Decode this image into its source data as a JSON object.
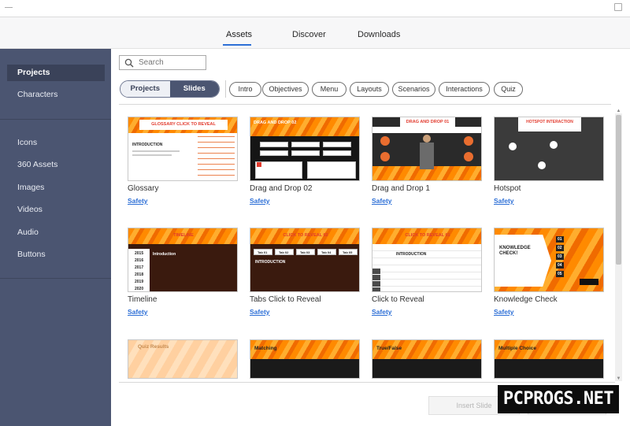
{
  "top_tabs": [
    {
      "label": "Assets",
      "active": true
    },
    {
      "label": "Discover",
      "active": false
    },
    {
      "label": "Downloads",
      "active": false
    }
  ],
  "sidebar": {
    "items": [
      {
        "label": "Projects",
        "active": true
      },
      {
        "label": "Characters"
      },
      {
        "label": "Icons"
      },
      {
        "label": "360 Assets"
      },
      {
        "label": "Images"
      },
      {
        "label": "Videos"
      },
      {
        "label": "Audio"
      },
      {
        "label": "Buttons"
      }
    ]
  },
  "search": {
    "placeholder": "Search",
    "icon": "search-icon"
  },
  "segment": {
    "left": "Projects",
    "right": "Slides",
    "selected": "Slides"
  },
  "filters": [
    "Intro",
    "Objectives",
    "Menu",
    "Layouts",
    "Scenarios",
    "Interactions",
    "Quiz"
  ],
  "cards": [
    {
      "title": "Glossary",
      "tag": "Safety",
      "thumb_heading": "GLOSSARY CLICK TO REVEAL",
      "thumb_sub": "INTRODUCTION"
    },
    {
      "title": "Drag and Drop 02",
      "tag": "Safety",
      "thumb_heading": "DRAG AND DROP 02"
    },
    {
      "title": "Drag and Drop 1",
      "tag": "Safety",
      "thumb_heading": "DRAG AND DROP 01"
    },
    {
      "title": "Hotspot",
      "tag": "Safety",
      "thumb_heading": "HOTSPOT INTERACTION"
    },
    {
      "title": "Timeline",
      "tag": "Safety",
      "thumb_heading": "TIMELINE",
      "thumb_sub": "Introduction",
      "years": [
        "2015",
        "2016",
        "2017",
        "2018",
        "2019",
        "2020"
      ]
    },
    {
      "title": "Tabs Click to Reveal",
      "tag": "Safety",
      "thumb_heading": "CLICK TO REVEAL 02",
      "thumb_sub": "INTRODUCTION",
      "tabs": [
        "Tab 01",
        "Tab 02",
        "Tab 03",
        "Tab 04",
        "Tab 05"
      ]
    },
    {
      "title": "Click to Reveal",
      "tag": "Safety",
      "thumb_heading": "CLICK TO REVEAL 01",
      "thumb_sub": "INTRODUCTION"
    },
    {
      "title": "Knowledge Check",
      "tag": "Safety",
      "thumb_heading": "KNOWLEDGE CHECK!",
      "options": [
        "01",
        "02",
        "03",
        "04",
        "05"
      ]
    },
    {
      "thumb_heading": "Quiz Results"
    },
    {
      "thumb_heading": "Matching"
    },
    {
      "thumb_heading": "True/False"
    },
    {
      "thumb_heading": "Multiple Choice"
    }
  ],
  "footer": {
    "insert_label": "Insert Slide",
    "cancel_label": ""
  },
  "watermark": "PCPROGS.NET",
  "colors": {
    "sidebar": "#4b5571",
    "accent": "#2d6fd6",
    "orange": "#ff8a00",
    "dark_brown": "#3a1a0e"
  }
}
